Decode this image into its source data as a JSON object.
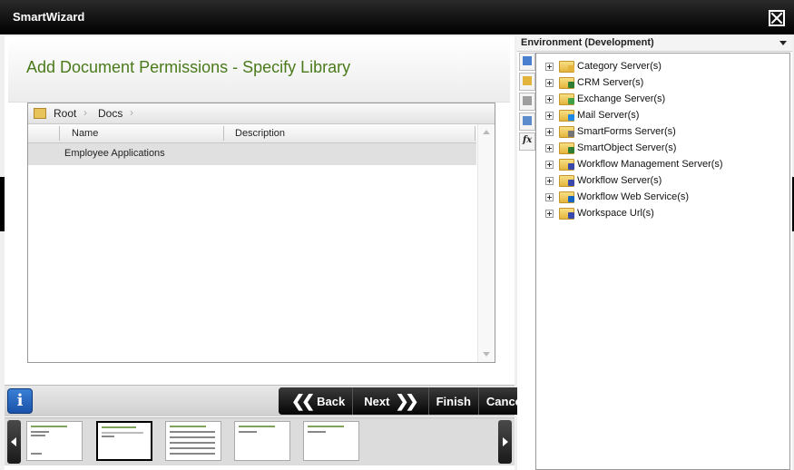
{
  "window": {
    "title": "SmartWizard"
  },
  "wizard": {
    "header_title": "Add Document Permissions - Specify Library",
    "breadcrumb": [
      "Root",
      "Docs"
    ],
    "columns": [
      "Name",
      "Description"
    ],
    "rows": [
      {
        "name": "Employee Applications",
        "description": ""
      }
    ],
    "buttons": {
      "back": "Back",
      "next": "Next",
      "finish": "Finish",
      "cancel": "Cancel"
    }
  },
  "environment": {
    "selected": "Environment (Development)",
    "tree": [
      {
        "label": "Category Server(s)",
        "badge_color": "#e3b43b"
      },
      {
        "label": "CRM Server(s)",
        "badge_color": "#2e7d32"
      },
      {
        "label": "Exchange Server(s)",
        "badge_color": "#43a047"
      },
      {
        "label": "Mail Server(s)",
        "badge_color": "#1e88e5"
      },
      {
        "label": "SmartForms Server(s)",
        "badge_color": "#757575"
      },
      {
        "label": "SmartObject Server(s)",
        "badge_color": "#2e7d32"
      },
      {
        "label": "Workflow Management Server(s)",
        "badge_color": "#3949ab"
      },
      {
        "label": "Workflow Server(s)",
        "badge_color": "#3949ab"
      },
      {
        "label": "Workflow Web Service(s)",
        "badge_color": "#1565c0"
      },
      {
        "label": "Workspace Url(s)",
        "badge_color": "#3949ab"
      }
    ]
  },
  "colors": {
    "title_green": "#4a7a1a",
    "info_blue": "#1a52a8"
  }
}
